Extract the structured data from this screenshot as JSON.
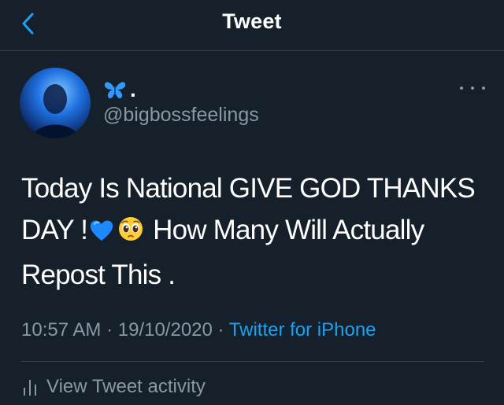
{
  "header": {
    "title": "Tweet",
    "back_icon": "chevron-left-icon",
    "accent": "#1da1f2"
  },
  "author": {
    "display_name_emoji": "butterfly-icon",
    "display_name_text": ".",
    "handle": "@bigbossfeelings"
  },
  "tweet": {
    "text_part1": "Today Is National GIVE GOD THANKS DAY !",
    "emoji1": "blue-heart-icon",
    "emoji2": "pleading-face-icon",
    "text_part2": " How Many Will Actually Repost This ."
  },
  "meta": {
    "time": "10:57 AM",
    "separator": "·",
    "date": "19/10/2020",
    "source": "Twitter for iPhone"
  },
  "activity": {
    "label": "View Tweet activity",
    "icon": "bar-chart-icon"
  },
  "colors": {
    "background": "#15202b",
    "secondary_text": "#8899a6",
    "divider": "#38444d",
    "link": "#1da1f2"
  }
}
